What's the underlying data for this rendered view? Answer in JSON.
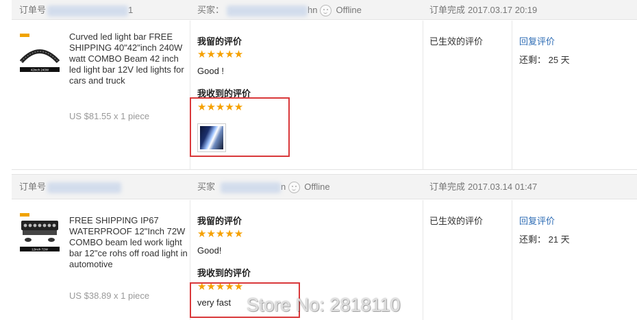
{
  "orders": [
    {
      "header": {
        "order_label": "订单号",
        "order_number_tail": "1",
        "buyer_label": "买家：",
        "buyer_name_tail": "hn",
        "buyer_status": "Offline",
        "completed_label": "订单完成",
        "completed_time": "2017.03.17 20:19"
      },
      "product": {
        "thumb_caption": "42inch 240W",
        "name": "Curved led light bar FREE SHIPPING 40\"42\"inch 240W watt COMBO Beam 42 inch led light bar 12V led lights for cars and truck",
        "price": "US $81.55 x 1 piece"
      },
      "feedback": {
        "left_title": "我留的评价",
        "left_stars": "★★★★★",
        "left_text": "Good !",
        "received_title": "我收到的评价",
        "received_stars": "★★★★★",
        "received_text": ""
      },
      "status": "已生效的评价",
      "action": {
        "reply_label": "回复评价",
        "remaining": "还剩： 25 天"
      }
    },
    {
      "header": {
        "order_label": "订单号",
        "order_number_tail": "",
        "buyer_label": "买家",
        "buyer_name_tail": "n",
        "buyer_status": "Offline",
        "completed_label": "订单完成",
        "completed_time": "2017.03.14 01:47"
      },
      "product": {
        "thumb_caption": "12inch 72W",
        "name": "FREE SHIPPING IP67 WATERPROOF 12\"Inch 72W COMBO beam led work light bar 12\"ce rohs off road light in automotive",
        "price": "US $38.89 x 1 piece"
      },
      "feedback": {
        "left_title": "我留的评价",
        "left_stars": "★★★★★",
        "left_text": "Good!",
        "received_title": "我收到的评价",
        "received_stars": "★★★★★",
        "received_text": "very fast"
      },
      "status": "已生效的评价",
      "action": {
        "reply_label": "回复评价",
        "remaining": "还剩： 21 天"
      }
    }
  ],
  "watermark": "Store No: 2818110",
  "colors": {
    "star": "#f5a000",
    "link": "#2f6db5",
    "highlight": "#d9383a",
    "header_bg": "#f3f3f3"
  }
}
